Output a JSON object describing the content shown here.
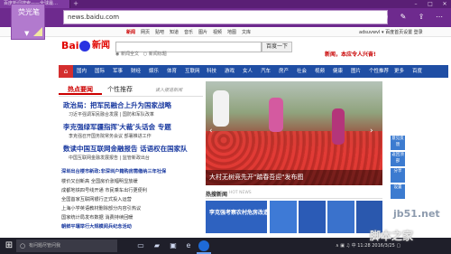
{
  "browser": {
    "tab_title": "百度新闻搜索——全球最…",
    "address": "news.baidu.com",
    "new_tab_symbol": "+",
    "window_controls": [
      "–",
      "□",
      "✕"
    ],
    "toolbar_icons": [
      "reading-view-icon",
      "favorites-icon",
      "hub-icon",
      "web-note-icon",
      "share-icon",
      "more-icon"
    ]
  },
  "note_overlay": {
    "label": "荧光笔"
  },
  "topnav": {
    "items": [
      "新闻",
      "网页",
      "贴吧",
      "知道",
      "音乐",
      "图片",
      "视频",
      "地图",
      "文库"
    ],
    "right_links": "adsuvwvl ▾  百度首页设置  登录"
  },
  "logo": {
    "bai": "Bai",
    "xinwen": "新闻"
  },
  "search": {
    "button": "百度一下",
    "radio_news": "新闻全文",
    "radio_title": "新闻标题"
  },
  "slogan": "新闻，本应令人兴奋!",
  "categories": {
    "home_symbol": "⌂",
    "items": [
      "国内",
      "国际",
      "军事",
      "财经",
      "娱乐",
      "体育",
      "互联网",
      "科技",
      "游戏",
      "女人",
      "汽车",
      "房产",
      "社会",
      "视频",
      "健康",
      "图片",
      "个性推荐",
      "更多",
      "百度"
    ]
  },
  "left": {
    "tab_hot": "热点要闻",
    "tab_recommend": "个性推荐",
    "hot_slogan": "读入报道新闻",
    "headlines": [
      {
        "title": "政治局：把军民融合上升为国家战略",
        "sub": "习近平强调军民融合发展 | 国防和军队改革"
      },
      {
        "title": "李克强绿军疆指挥'大裁'头话会 专题",
        "sub": "李克强召开国务院常务会议 部署推进工作"
      },
      {
        "title": "数读中国互联网金融报告 话语权在国家队",
        "sub": "中国互联网金融发展报告 | 监管新政出台"
      }
    ],
    "list": [
      "深圳出台楼市新政:非深圳户籍购房需缴纳三年社保",
      "楼价又创新高 全国房价涨幅明显放缓",
      "成都地铁四号线开通 市民乘车出行更便利",
      "全国首家互联网银行正式投入运营",
      "上海小学英语教材删除部分内容引热议",
      "国家统计局发布数据 消费持续回暖",
      "外交部回应中国游客在国外被打事件",
      "朝鲜平壤举行大规模阅兵纪念活动"
    ]
  },
  "photo": {
    "caption": "大村无树竞先开\"踏春吾迎\"发布图"
  },
  "side_buttons": [
    "意见反馈",
    "返回顶部",
    "分享",
    "设置"
  ],
  "bottom": {
    "title": "热搜新闻",
    "title_en": "HOT NEWS",
    "tile_title": "李克强考察农村危房改造"
  },
  "taskbar": {
    "start_symbol": "⊞",
    "search_placeholder": "有问题尽管问我",
    "tray": "∧  ▣  ♫  中  11:28  2016/3/25  ▢"
  },
  "watermark": {
    "url": "jb51.net",
    "text": "脚本之家"
  }
}
